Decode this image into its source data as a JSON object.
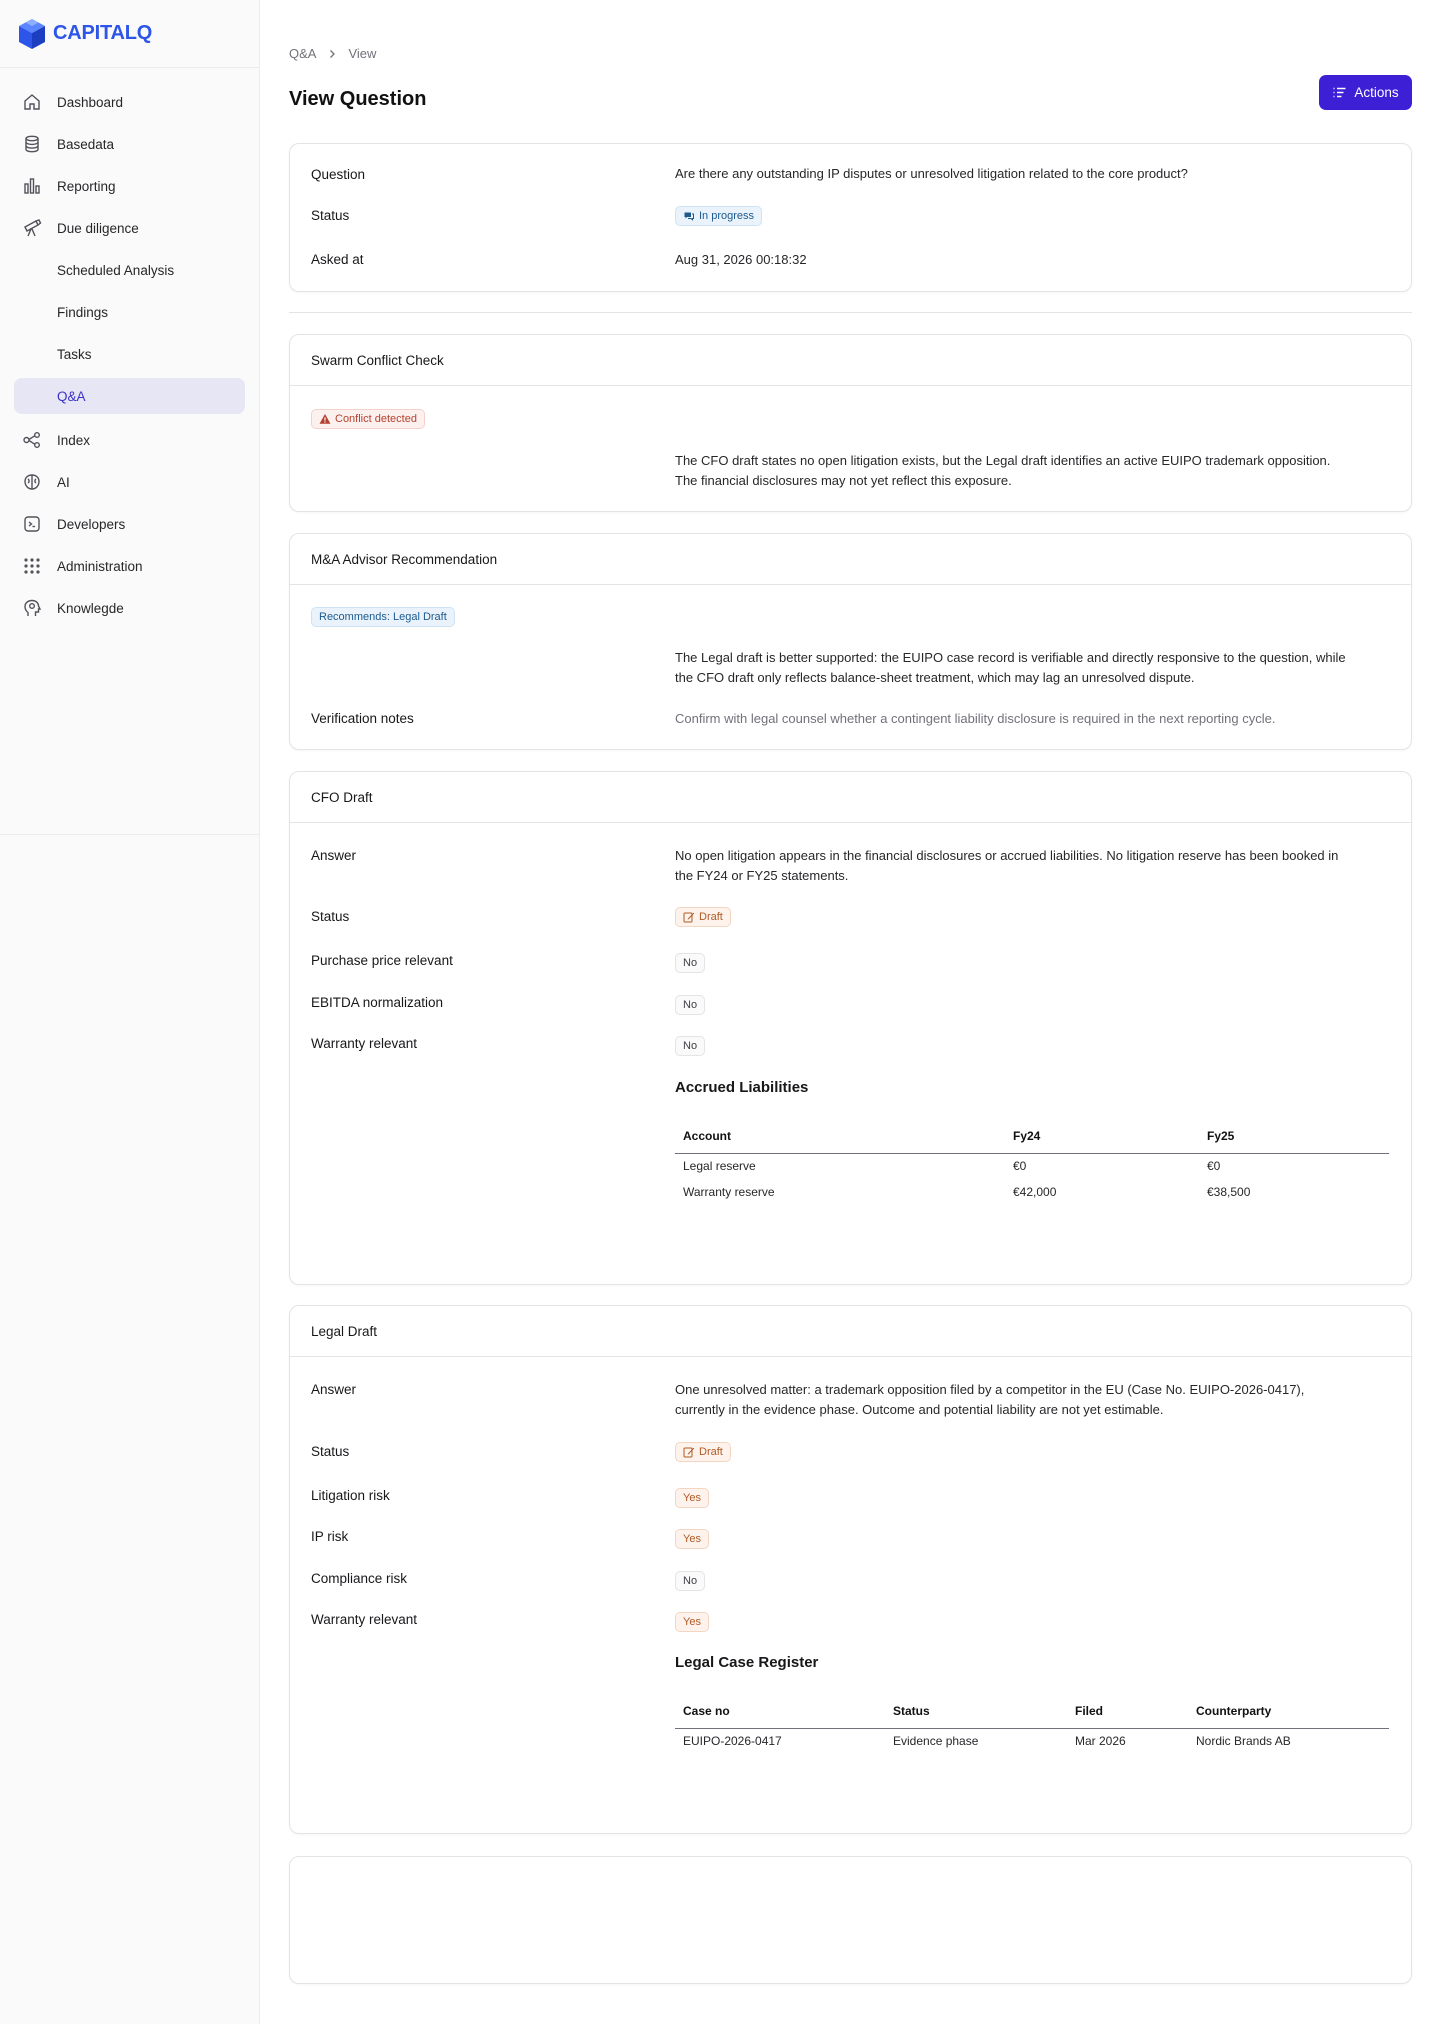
{
  "brand": {
    "name": "CAPITALQ",
    "color": "#2d55e8"
  },
  "sidebar": {
    "items": [
      {
        "label": "Dashboard",
        "icon": "home-icon"
      },
      {
        "label": "Basedata",
        "icon": "database-icon"
      },
      {
        "label": "Reporting",
        "icon": "bar-chart-icon"
      },
      {
        "label": "Due diligence",
        "icon": "telescope-icon"
      }
    ],
    "sub_items": [
      {
        "label": "Scheduled Analysis"
      },
      {
        "label": "Findings"
      },
      {
        "label": "Tasks"
      },
      {
        "label": "Q&A",
        "active": true
      }
    ],
    "items_after": [
      {
        "label": "Index",
        "icon": "graph-icon"
      },
      {
        "label": "AI",
        "icon": "brain-icon"
      },
      {
        "label": "Developers",
        "icon": "terminal-icon"
      },
      {
        "label": "Administration",
        "icon": "grid-dots-icon"
      },
      {
        "label": "Knowlegde",
        "icon": "head-icon"
      }
    ]
  },
  "breadcrumb": {
    "parent": "Q&A",
    "current": "View"
  },
  "page": {
    "title": "View Question",
    "actions_label": "Actions",
    "accent": "#3d1fd6"
  },
  "question_card": {
    "question_label": "Question",
    "question_value": "Are there any outstanding IP disputes or unresolved litigation related to the core product?",
    "status_label": "Status",
    "status_value": "In progress",
    "asked_label": "Asked at",
    "asked_value": "Aug 31, 2026 00:18:32"
  },
  "conflict_card": {
    "title": "Swarm Conflict Check",
    "badge": "Conflict detected",
    "text_line1": "The CFO draft states no open litigation exists, but the Legal draft identifies an active EUIPO trademark opposition.",
    "text_line2": "The financial disclosures may not yet reflect this exposure."
  },
  "advisor_card": {
    "title": "M&A Advisor Recommendation",
    "badge": "Recommends: Legal Draft",
    "text_line1": "The Legal draft is better supported: the EUIPO case record is verifiable and directly responsive to the question, while",
    "text_line2": "the CFO draft only reflects balance-sheet treatment, which may lag an unresolved dispute.",
    "notes_label": "Verification notes",
    "notes_value": "Confirm with legal counsel whether a contingent liability disclosure is required in the next reporting cycle."
  },
  "cfo_card": {
    "title": "CFO Draft",
    "answer_label": "Answer",
    "answer_line1": "No open litigation appears in the financial disclosures or accrued liabilities. No litigation reserve has been booked in",
    "answer_line2": "the FY24 or FY25 statements.",
    "status_label": "Status",
    "status_value": "Draft",
    "fields": [
      {
        "label": "Purchase price relevant",
        "value": "No"
      },
      {
        "label": "EBITDA normalization",
        "value": "No"
      },
      {
        "label": "Warranty relevant",
        "value": "No"
      }
    ],
    "table_title": "Accrued Liabilities",
    "table": {
      "headers": [
        "Account",
        "Fy24",
        "Fy25"
      ],
      "rows": [
        [
          "Legal reserve",
          "€0",
          "€0"
        ],
        [
          "Warranty reserve",
          "€42,000",
          "€38,500"
        ]
      ]
    }
  },
  "legal_card": {
    "title": "Legal Draft",
    "answer_label": "Answer",
    "answer_line1": "One unresolved matter: a trademark opposition filed by a competitor in the EU (Case No. EUIPO-2026-0417),",
    "answer_line2": "currently in the evidence phase. Outcome and potential liability are not yet estimable.",
    "status_label": "Status",
    "status_value": "Draft",
    "fields": [
      {
        "label": "Litigation risk",
        "value": "Yes"
      },
      {
        "label": "IP risk",
        "value": "Yes"
      },
      {
        "label": "Compliance risk",
        "value": "No"
      },
      {
        "label": "Warranty relevant",
        "value": "Yes"
      }
    ],
    "table_title": "Legal Case Register",
    "table": {
      "headers": [
        "Case no",
        "Status",
        "Filed",
        "Counterparty"
      ],
      "rows": [
        [
          "EUIPO-2026-0417",
          "Evidence phase",
          "Mar 2026",
          "Nordic Brands AB"
        ]
      ]
    }
  }
}
